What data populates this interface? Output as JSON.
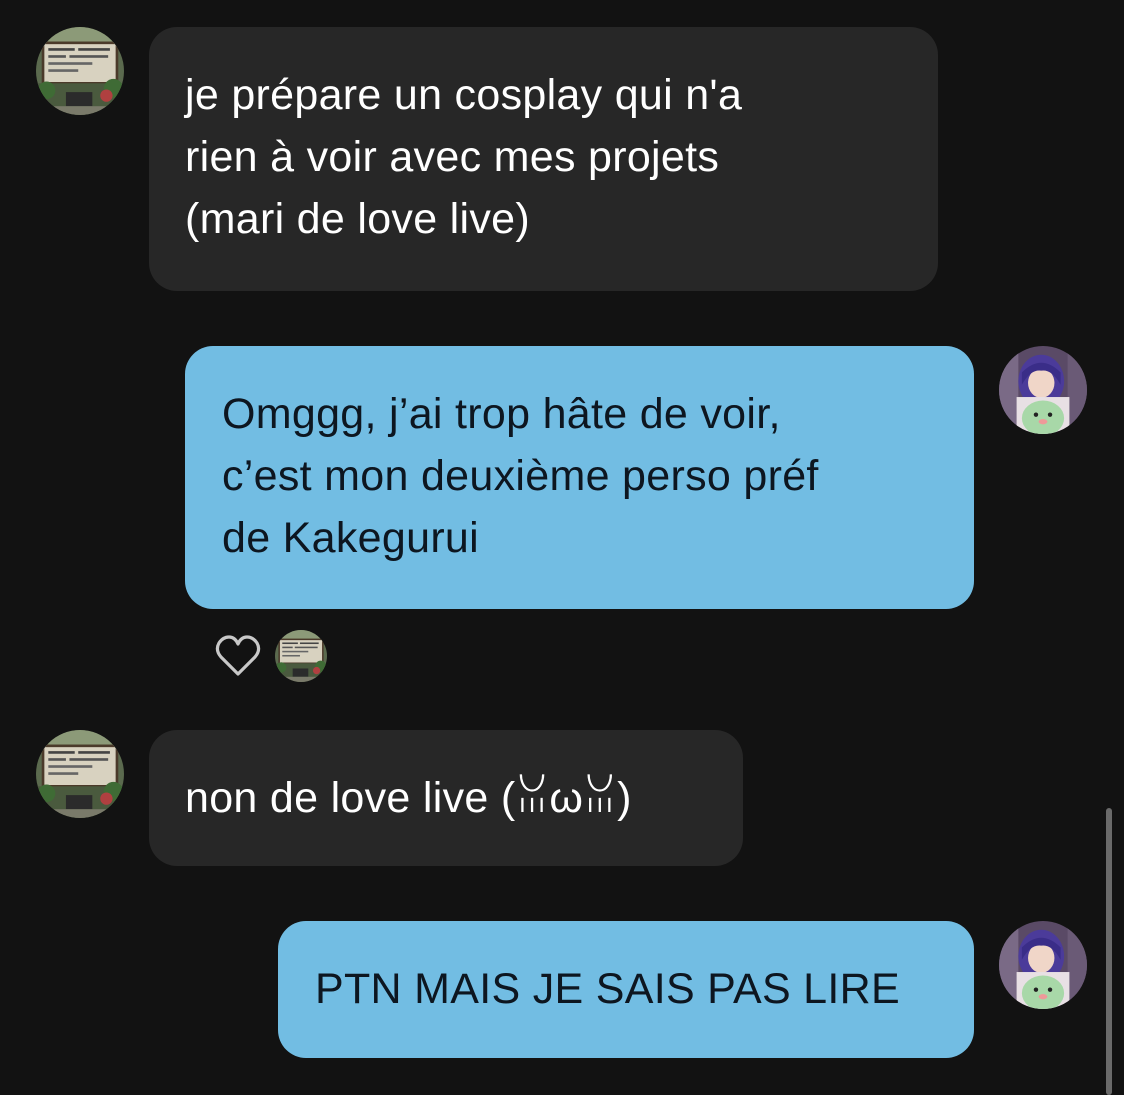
{
  "messages": [
    {
      "sender": "other",
      "text": "je prépare un cosplay qui n'a\nrien à voir avec mes projets\n(mari de love live)",
      "avatar_icon": "sign-board-avatar-icon"
    },
    {
      "sender": "self",
      "text": "Omggg, j’ai trop hâte de voir,\nc’est mon deuxième perso préf\nde Kakegurui",
      "avatar_icon": "purple-hair-person-avatar-icon",
      "reaction": {
        "icon": "heart-outline-icon",
        "reactor_avatar_icon": "sign-board-avatar-icon"
      }
    },
    {
      "sender": "other",
      "text": "non de love live (ꈍωꈍ)",
      "avatar_icon": "sign-board-avatar-icon"
    },
    {
      "sender": "self",
      "text": "PTN MAIS JE SAIS PAS LIRE",
      "avatar_icon": "purple-hair-person-avatar-icon"
    }
  ],
  "colors": {
    "background": "#121212",
    "incoming_bubble": "#272727",
    "outgoing_bubble": "#72bde3",
    "incoming_text": "#ffffff",
    "outgoing_text": "#0d1620"
  }
}
